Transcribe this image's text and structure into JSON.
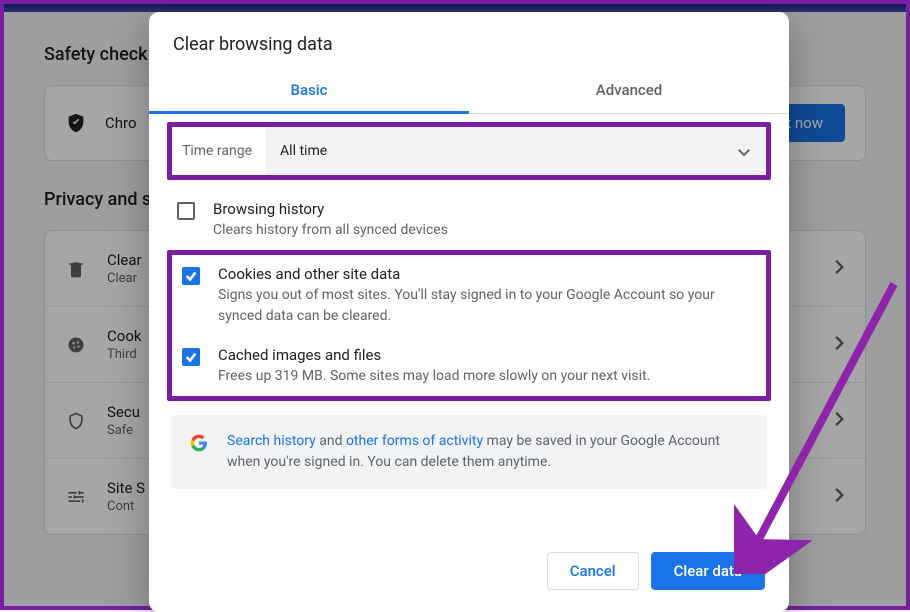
{
  "bg": {
    "safety_title": "Safety check",
    "chrome_line": "Chro",
    "check_now_btn": "eck now",
    "privacy_title": "Privacy and s",
    "items": [
      {
        "title": "Clear",
        "sub": "Clear"
      },
      {
        "title": "Cook",
        "sub": "Third"
      },
      {
        "title": "Secu",
        "sub": "Safe"
      },
      {
        "title": "Site S",
        "sub": "Cont"
      }
    ]
  },
  "dialog": {
    "title": "Clear browsing data",
    "tab_basic": "Basic",
    "tab_advanced": "Advanced",
    "time_range_label": "Time range",
    "time_range_value": "All time",
    "options": {
      "browsing_history": {
        "title": "Browsing history",
        "sub": "Clears history from all synced devices"
      },
      "cookies": {
        "title": "Cookies and other site data",
        "sub": "Signs you out of most sites. You'll stay signed in to your Google Account so your synced data can be cleared."
      },
      "cache": {
        "title": "Cached images and files",
        "sub": "Frees up 319 MB. Some sites may load more slowly on your next visit."
      }
    },
    "info": {
      "link1": "Search history",
      "mid1": " and ",
      "link2": "other forms of activity",
      "tail": " may be saved in your Google Account when you're signed in. You can delete them anytime."
    },
    "cancel": "Cancel",
    "confirm": "Clear data"
  }
}
